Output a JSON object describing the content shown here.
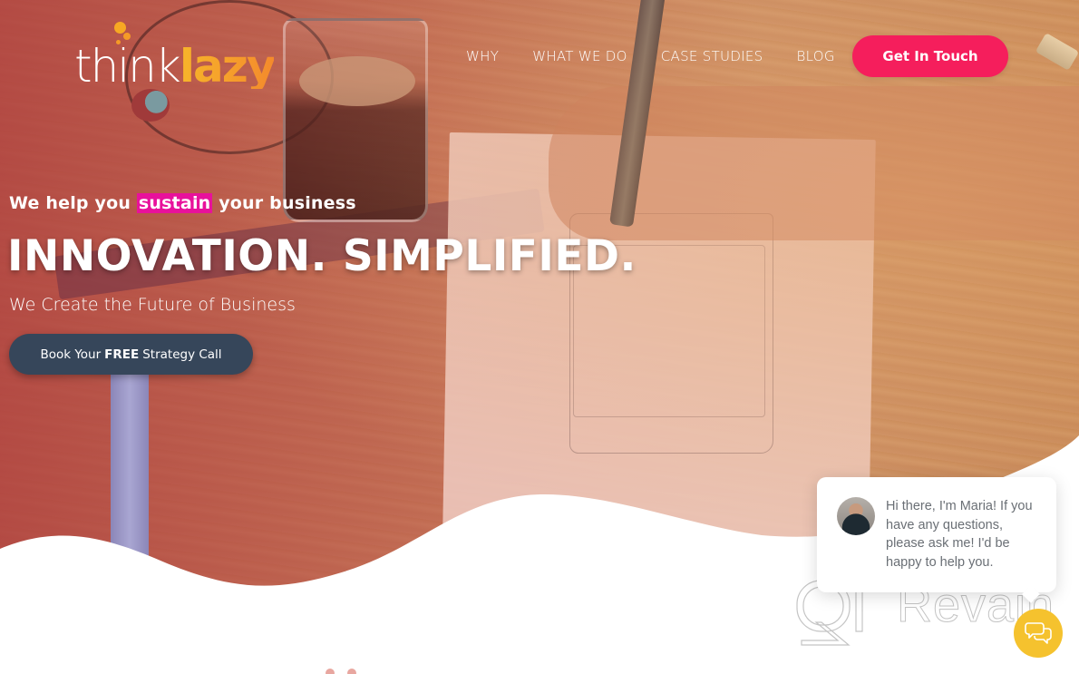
{
  "brand": {
    "logo_part1": "think",
    "logo_part2": "lazy",
    "accent_color": "#f51e5c",
    "logo_orange": "#f7a823"
  },
  "nav": {
    "links": [
      {
        "label": "WHY"
      },
      {
        "label": "WHAT WE DO"
      },
      {
        "label": "CASE STUDIES"
      },
      {
        "label": "BLOG"
      }
    ],
    "cta_label": "Get In Touch"
  },
  "hero": {
    "tagline_before": "We help you ",
    "tagline_highlight": "sustain",
    "tagline_after": " your business",
    "highlight_color": "#e8119b",
    "headline": "INNOVATION. SIMPLIFIED.",
    "subheadline": "We Create the Future of Business",
    "cta": {
      "prefix": "Book Your",
      "bold": "FREE",
      "suffix": "Strategy Call",
      "color": "#36465a"
    }
  },
  "chat": {
    "message": "Hi there, I'm Maria! If you have any questions, please ask me! I'd be happy to help you.",
    "agent_name": "Maria",
    "launcher_icon": "chat-bubbles-icon",
    "launcher_color": "#f5c22e"
  },
  "watermark": {
    "text": "Revain"
  }
}
